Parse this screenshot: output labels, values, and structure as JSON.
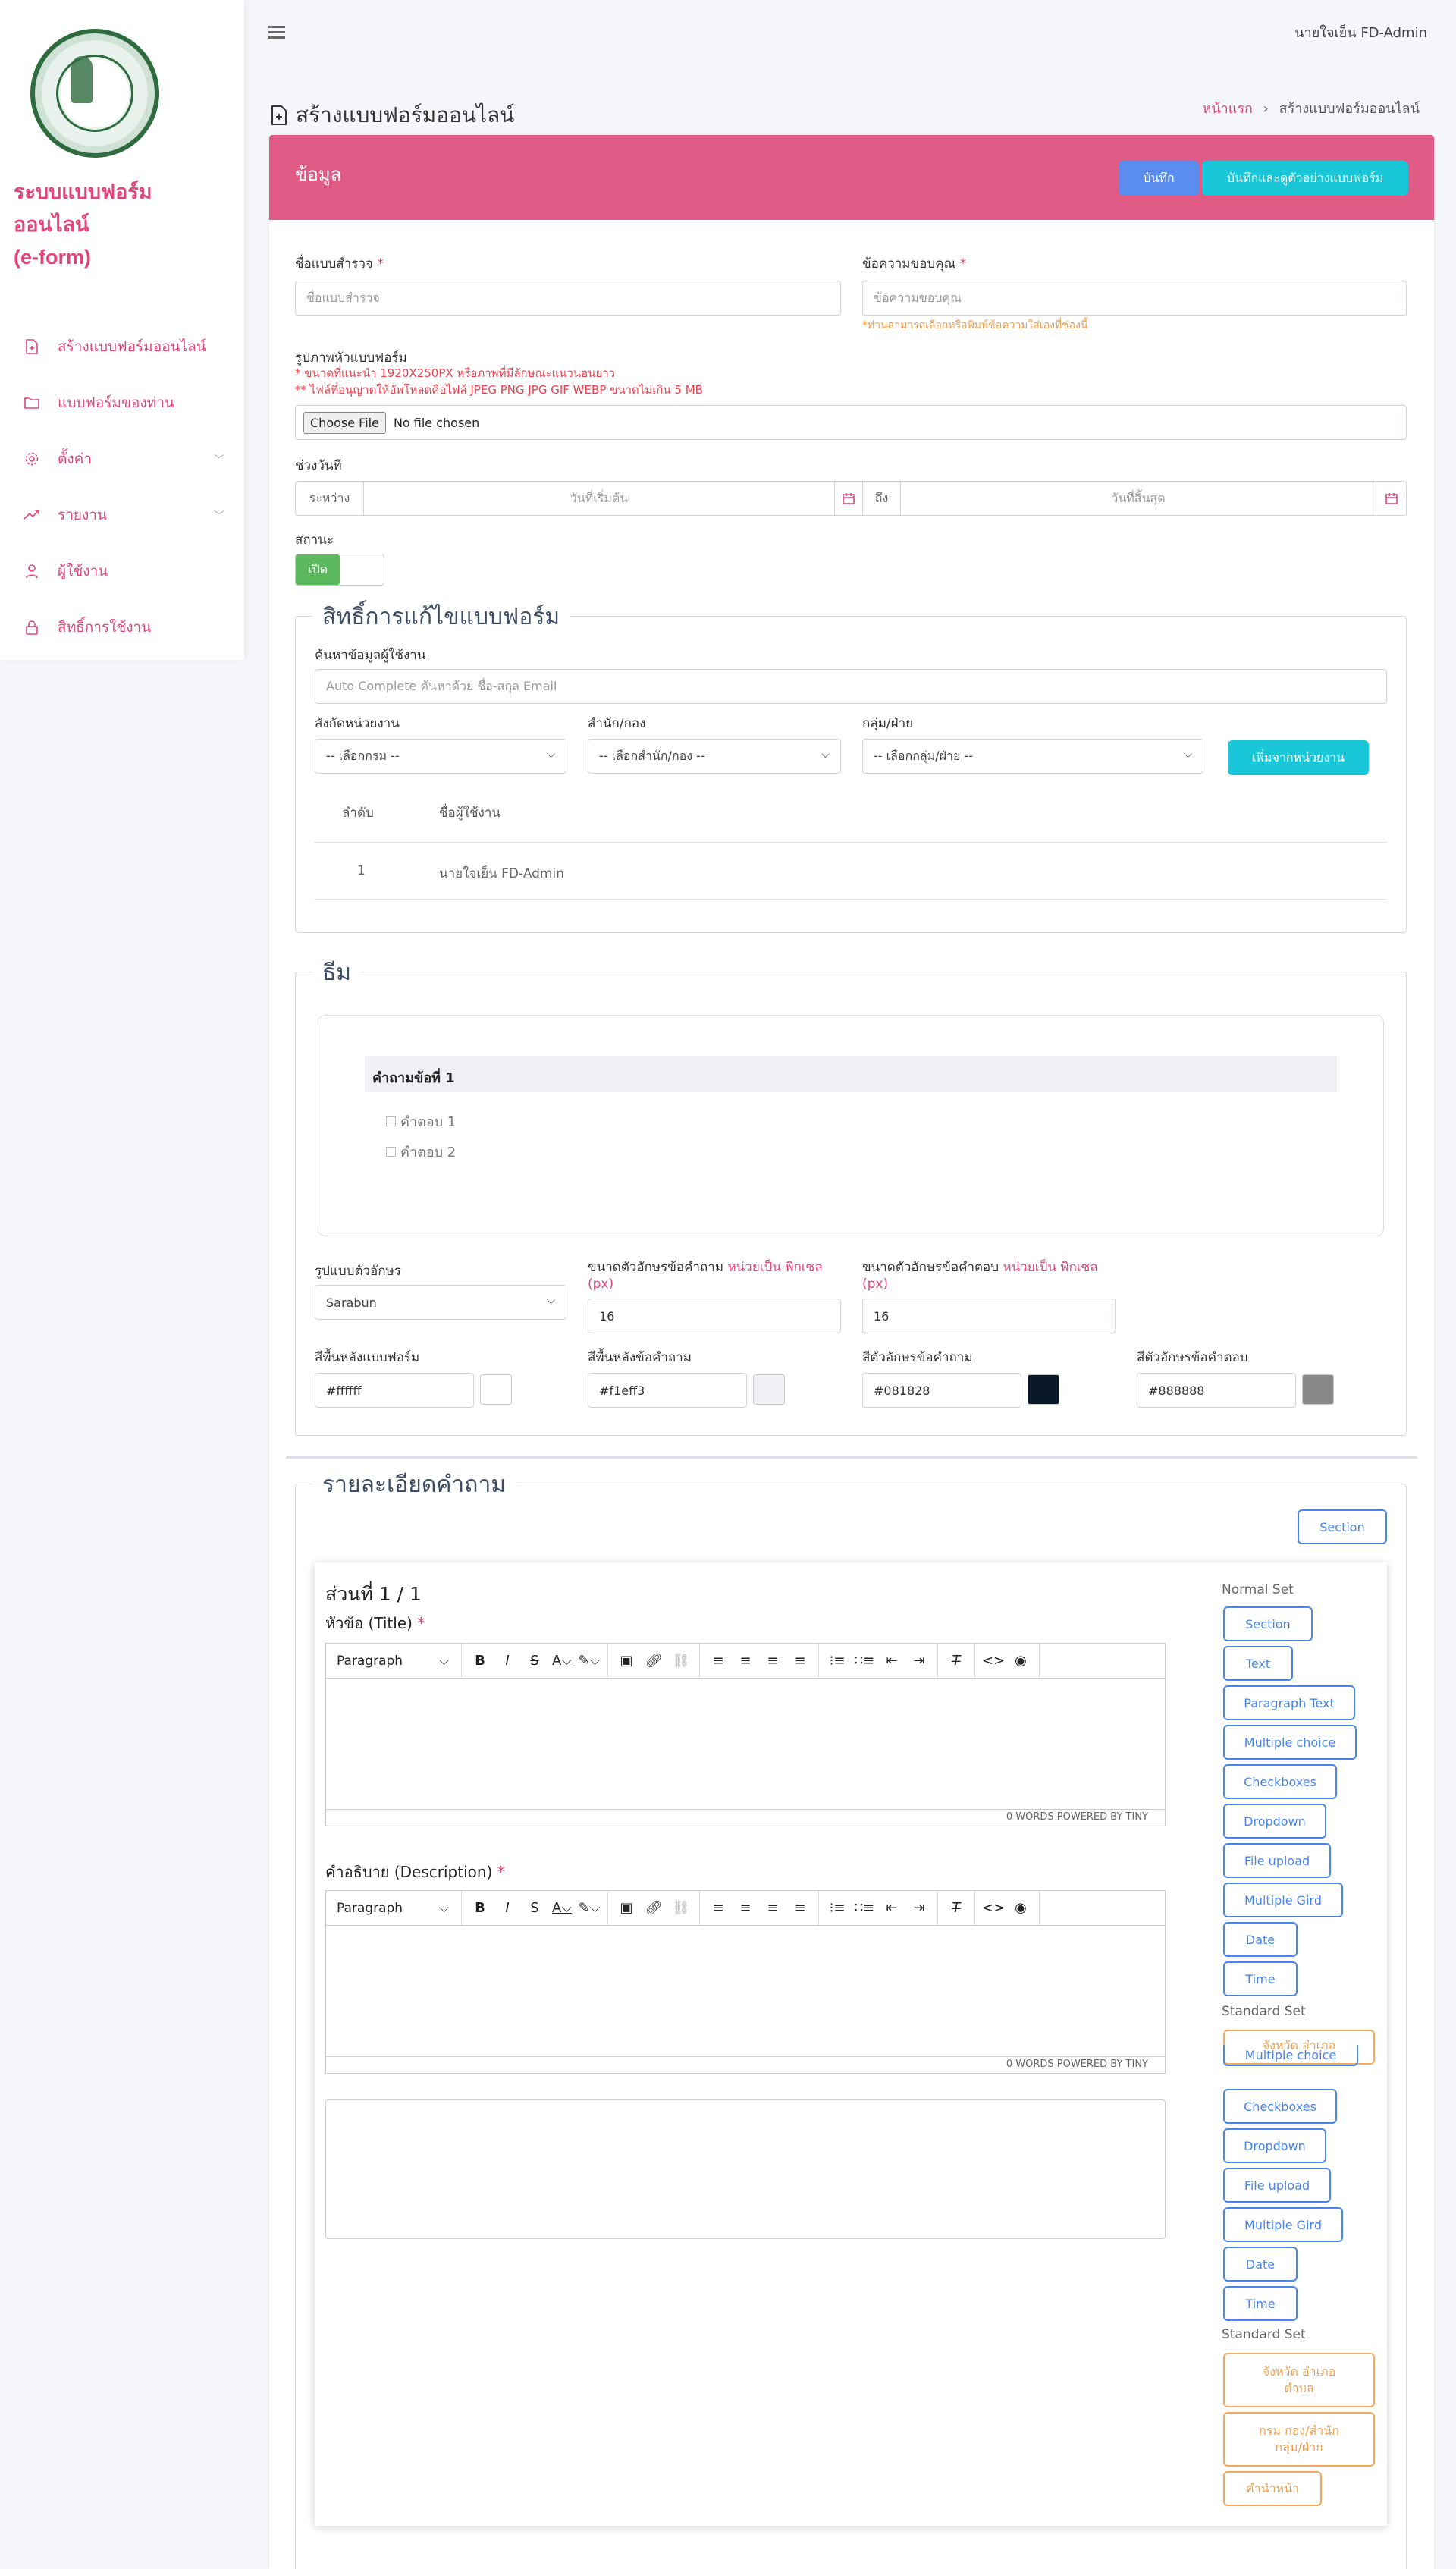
{
  "app": {
    "name_line1": "ระบบแบบฟอร์ม",
    "name_line2": "ออนไลน์",
    "name_line3": "(e-form)"
  },
  "sidebar": {
    "items": [
      {
        "label": "สร้างแบบฟอร์มออนไลน์",
        "icon": "file-plus-icon",
        "chev": ""
      },
      {
        "label": "แบบฟอร์มของท่าน",
        "icon": "folder-icon",
        "chev": ""
      },
      {
        "label": "ตั้งค่า",
        "icon": "gear-icon",
        "chev": "﹀"
      },
      {
        "label": "รายงาน",
        "icon": "trend-icon",
        "chev": "﹀"
      },
      {
        "label": "ผู้ใช้งาน",
        "icon": "user-icon",
        "chev": ""
      },
      {
        "label": "สิทธิ์การใช้งาน",
        "icon": "lock-icon",
        "chev": ""
      }
    ]
  },
  "topbar": {
    "user": "นายใจเย็น FD-Admin"
  },
  "page": {
    "title": "สร้างแบบฟอร์มออนไลน์",
    "bc_home": "หน้าแรก",
    "bc_sep": "›",
    "bc_current": "สร้างแบบฟอร์มออนไลน์"
  },
  "card": {
    "title": "ข้อมูล",
    "save": "บันทึก",
    "save_preview": "บันทึกและดูตัวอย่างแบบฟอร์ม"
  },
  "form": {
    "survey_name_label": "ชื่อแบบสำรวจ",
    "survey_name_ph": "ชื่อแบบสำรวจ",
    "thanks_label": "ข้อความขอบคุณ",
    "thanks_ph": "ข้อความขอบคุณ",
    "thanks_hint": "*ท่านสามารถเลือกหรือพิมพ์ข้อความใส่เองที่ช่องนี้",
    "header_img_label": "รูปภาพหัวแบบฟอร์ม",
    "header_img_hint1": "* ขนาดที่แนะนำ 1920X250PX หรือภาพที่มีลักษณะแนวนอนยาว",
    "header_img_hint2": "** ไฟล์ที่อนุญาตให้อัพโหลดคือไฟล์ JPEG PNG JPG GIF WEBP ขนาดไม่เกิน 5 MB",
    "choose_file": "Choose File",
    "no_file": "No file chosen",
    "date_label": "ช่วงวันที่",
    "between": "ระหว่าง",
    "start_ph": "วันที่เริ่มต้น",
    "to": "ถึง",
    "end_ph": "วันที่สิ้นสุด",
    "status_label": "สถานะ",
    "status_on": "เปิด"
  },
  "permission": {
    "legend": "สิทธิ์การแก้ไขแบบฟอร์ม",
    "search_label": "ค้นหาข้อมูลผู้ใช้งาน",
    "search_ph": "Auto Complete ค้นหาด้วย ชื่อ-สกุล Email",
    "dept_label": "สังกัดหน่วยงาน",
    "dept_value": "-- เลือกกรม --",
    "office_label": "สำนัก/กอง",
    "office_value": "-- เลือกสำนัก/กอง --",
    "group_label": "กลุ่ม/ฝ่าย",
    "group_value": "-- เลือกกลุ่ม/ฝ่าย --",
    "add_btn": "เพิ่มจากหน่วยงาน",
    "col_no": "ลำดับ",
    "col_user": "ชื่อผู้ใช้งาน",
    "rows": [
      {
        "no": "1",
        "user": "นายใจเย็น FD-Admin"
      }
    ]
  },
  "theme": {
    "legend": "ธีม",
    "preview_q": "คำถามข้อที่ 1",
    "preview_a1": "คำตอบ 1",
    "preview_a2": "คำตอบ 2",
    "font_label": "รูปแบบตัวอักษร",
    "font_value": "Sarabun",
    "qsize_label": "ขนาดตัวอักษรข้อคำถาม ",
    "qsize_unit": "หน่วยเป็น พิกเซล (px)",
    "qsize_value": "16",
    "asize_label": "ขนาดตัวอักษรข้อคำตอบ ",
    "asize_unit": "หน่วยเป็น พิกเซล (px)",
    "asize_value": "16",
    "bg_label": "สีพื้นหลังแบบฟอร์ม",
    "bg_value": "#ffffff",
    "qbg_label": "สีพื้นหลังข้อคำถาม",
    "qbg_value": "#f1eff3",
    "qcolor_label": "สีตัวอักษรข้อคำถาม",
    "qcolor_value": "#081828",
    "acolor_label": "สีตัวอักษรข้อคำตอบ",
    "acolor_value": "#888888"
  },
  "details": {
    "legend": "รายละเอียดคำถาม",
    "section_btn": "Section",
    "part": "ส่วนที่ 1 / 1",
    "title_label": "หัวข้อ (Title)",
    "desc_label": "คำอธิบาย (Description)",
    "paragraph": "Paragraph",
    "words": "0 WORDS  POWERED BY TINY"
  },
  "palette": {
    "normal_set": "Normal Set",
    "standard_set": "Standard Set",
    "normal": [
      "Section",
      "Text",
      "Paragraph Text",
      "Multiple choice",
      "Checkboxes",
      "Dropdown",
      "File upload",
      "Multiple Gird",
      "Date",
      "Time"
    ],
    "overlap_orange": "จังหวัด อำเภอ",
    "overlap_blue": "Multiple choice",
    "std_blue": [
      "Checkboxes",
      "Dropdown",
      "File upload",
      "Multiple Gird",
      "Date",
      "Time"
    ],
    "std2": "Standard Set",
    "std_orange": [
      "จังหวัด อำเภอ ตำบล",
      "กรม กอง/สำนัก กลุ่ม/ฝ่าย",
      "คำนำหน้า"
    ]
  },
  "colors": {
    "brand": "#e0457b",
    "header": "#e05a86",
    "save": "#5b8def",
    "preview": "#19c7d8",
    "toggle": "#5cb85c"
  }
}
